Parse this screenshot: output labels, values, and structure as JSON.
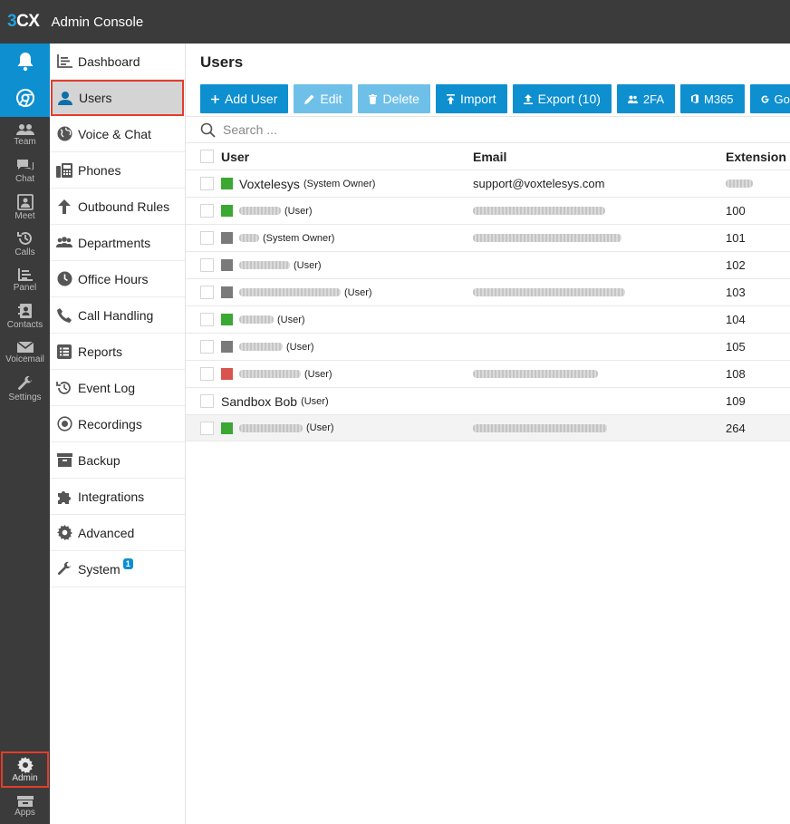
{
  "app": {
    "logo_part1": "3",
    "logo_part2": "CX",
    "title": "Admin Console"
  },
  "rail": {
    "items": [
      {
        "label": "Team"
      },
      {
        "label": "Chat"
      },
      {
        "label": "Meet"
      },
      {
        "label": "Calls"
      },
      {
        "label": "Panel"
      },
      {
        "label": "Contacts"
      },
      {
        "label": "Voicemail"
      },
      {
        "label": "Settings"
      }
    ],
    "admin": "Admin",
    "apps": "Apps"
  },
  "nav": {
    "items": [
      {
        "label": "Dashboard"
      },
      {
        "label": "Users"
      },
      {
        "label": "Voice & Chat"
      },
      {
        "label": "Phones"
      },
      {
        "label": "Outbound Rules"
      },
      {
        "label": "Departments"
      },
      {
        "label": "Office Hours"
      },
      {
        "label": "Call Handling"
      },
      {
        "label": "Reports"
      },
      {
        "label": "Event Log"
      },
      {
        "label": "Recordings"
      },
      {
        "label": "Backup"
      },
      {
        "label": "Integrations"
      },
      {
        "label": "Advanced"
      },
      {
        "label": "System"
      }
    ],
    "system_badge": "1"
  },
  "page": {
    "title": "Users"
  },
  "toolbar": {
    "add_user": "Add User",
    "edit": "Edit",
    "delete": "Delete",
    "import": "Import",
    "export": "Export (10)",
    "twofa": "2FA",
    "m365": "M365",
    "google": "Goog"
  },
  "search": {
    "placeholder": "Search ..."
  },
  "table": {
    "headers": {
      "user": "User",
      "email": "Email",
      "extension": "Extension"
    },
    "rows": [
      {
        "name": "Voxtelesys",
        "role": "(System Owner)",
        "email": "support@voxtelesys.com",
        "extension": "",
        "status_color": "#3aa832"
      },
      {
        "name": "",
        "role": "(User)",
        "email": "",
        "extension": "100",
        "status_color": "#3aa832"
      },
      {
        "name": "",
        "role": "(System Owner)",
        "email": "",
        "extension": "101",
        "status_color": "#7a7a7a"
      },
      {
        "name": "",
        "role": "(User)",
        "email": "",
        "extension": "102",
        "status_color": "#7a7a7a"
      },
      {
        "name": "",
        "role": "(User)",
        "email": "",
        "extension": "103",
        "status_color": "#7a7a7a"
      },
      {
        "name": "",
        "role": "(User)",
        "email": "",
        "extension": "104",
        "status_color": "#3aa832"
      },
      {
        "name": "",
        "role": "(User)",
        "email": "",
        "extension": "105",
        "status_color": "#7a7a7a"
      },
      {
        "name": "",
        "role": "(User)",
        "email": "",
        "extension": "108",
        "status_color": "#d9534f"
      },
      {
        "name": "Sandbox Bob",
        "role": "(User)",
        "email": "",
        "extension": "109",
        "status_color": ""
      },
      {
        "name": "",
        "role": "(User)",
        "email": "",
        "extension": "264",
        "status_color": "#3aa832"
      }
    ]
  },
  "colors": {
    "accent": "#0d8fd0",
    "highlight_border": "#e23d2c",
    "online": "#3aa832",
    "offline": "#7a7a7a",
    "dnd": "#d9534f"
  }
}
